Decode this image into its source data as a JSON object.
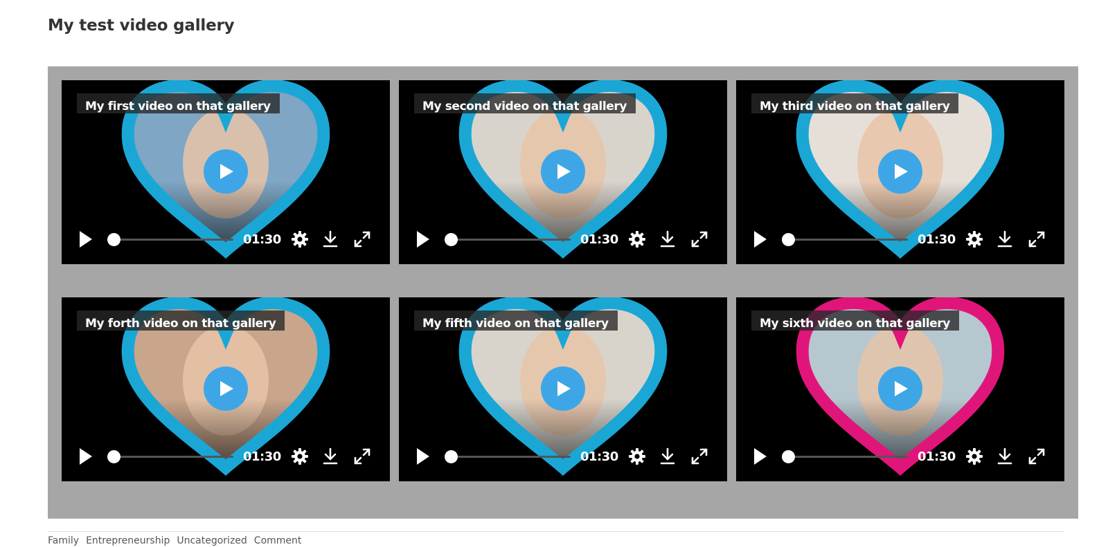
{
  "page": {
    "title": "My test video gallery"
  },
  "colors": {
    "gallery_background": "#a6a6a6",
    "player_background": "#000000",
    "heart_blue": "#1aa7d6",
    "heart_pink": "#e0157a",
    "play_button": "#3ea6e6"
  },
  "videos": [
    {
      "title": "My first video on that gallery",
      "time": "01:30",
      "heart_color": "#1aa7d6",
      "thumb": "#7fa6c4",
      "progress": 0
    },
    {
      "title": "My second video on that gallery",
      "time": "01:30",
      "heart_color": "#1aa7d6",
      "thumb": "#d8d4cc",
      "progress": 0
    },
    {
      "title": "My third video on that gallery",
      "time": "01:30",
      "heart_color": "#1aa7d6",
      "thumb": "#e6dfd8",
      "progress": 0
    },
    {
      "title": "My forth video on that gallery",
      "time": "01:30",
      "heart_color": "#1aa7d6",
      "thumb": "#c9a58c",
      "progress": 0
    },
    {
      "title": "My fifth video on that gallery",
      "time": "01:30",
      "heart_color": "#1aa7d6",
      "thumb": "#d8d4cc",
      "progress": 0
    },
    {
      "title": "My sixth video on that gallery",
      "time": "01:30",
      "heart_color": "#e0157a",
      "thumb": "#b7c7cf",
      "progress": 0
    }
  ],
  "controls": {
    "icons": [
      "play-icon",
      "settings-gear-icon",
      "download-icon",
      "fullscreen-icon"
    ]
  },
  "footer": {
    "links": [
      "Family",
      "Entrepreneurship",
      "Uncategorized",
      "Comment"
    ]
  }
}
